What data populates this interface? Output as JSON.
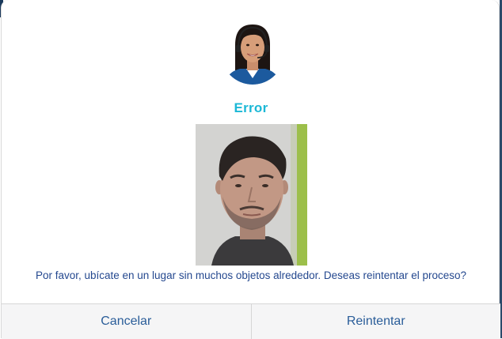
{
  "dialog": {
    "title": "Error",
    "message": "Por favor, ubícate en un lugar sin muchos objetos alrededor. Deseas reintentar el proceso?",
    "cancel_label": "Cancelar",
    "retry_label": "Reintentar"
  },
  "colors": {
    "title": "#1bb8d6",
    "message_text": "#24488f",
    "button_text": "#2a5d99",
    "footer_background": "#f5f5f6"
  },
  "icons": {
    "avatar": "support-agent-avatar-icon"
  }
}
